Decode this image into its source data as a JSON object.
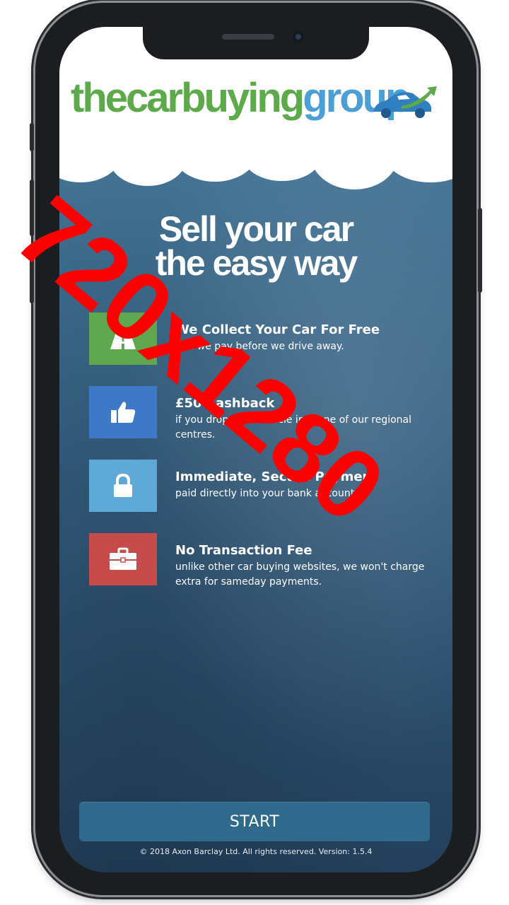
{
  "watermark": "720x1280",
  "brand": {
    "logo_the": "the",
    "logo_car": "car",
    "logo_buying": "buying",
    "logo_group": "group",
    "logo_icon": "car-arrow-icon"
  },
  "headline": {
    "line1": "Sell your car",
    "line2": "the easy way"
  },
  "features": [
    {
      "title": "We Collect Your Car For Free",
      "desc": "and we pay before we drive away.",
      "icon": "road-icon",
      "color": "#5fa84f"
    },
    {
      "title": "£50 Cashback",
      "desc": "if you drop your vehicle into one of our regional centres.",
      "icon": "thumbs-up-icon",
      "color": "#3d79c7"
    },
    {
      "title": "Immediate, Secure Payment",
      "desc": "paid directly into your bank account.",
      "icon": "lock-icon",
      "color": "#5fa9d6"
    },
    {
      "title": "No Transaction Fee",
      "desc": "unlike other car buying websites, we won't charge extra for sameday payments.",
      "icon": "briefcase-icon",
      "color": "#c64c4c"
    }
  ],
  "start_button": "START",
  "footer": "© 2018 Axon Barclay Ltd. All rights reserved. Version: 1.5.4"
}
